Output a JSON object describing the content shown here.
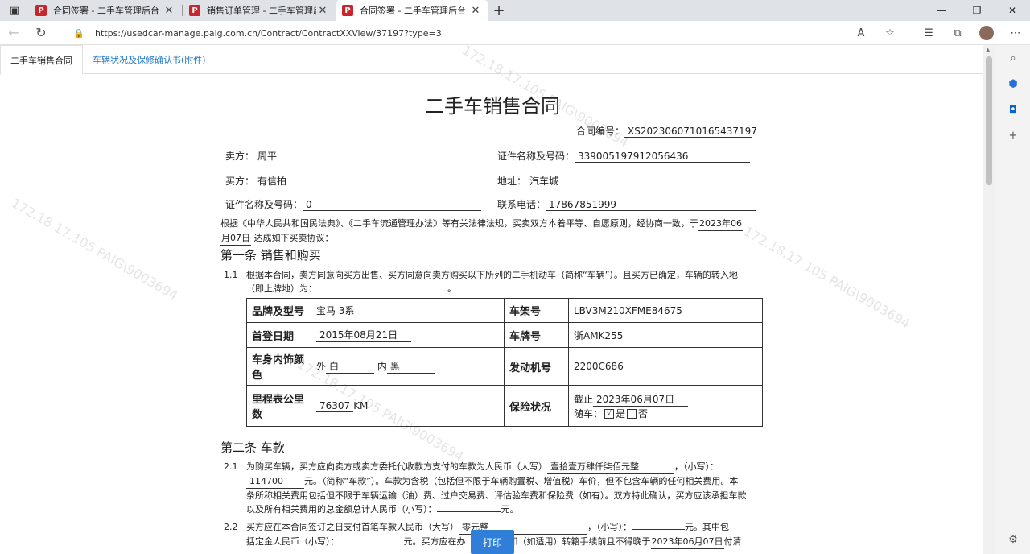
{
  "browser": {
    "tabs": [
      {
        "title": "合同签署 - 二手车管理后台",
        "favicon": "P"
      },
      {
        "title": "销售订单管理 - 二手车管理后台",
        "favicon": "P"
      },
      {
        "title": "合同签署 - 二手车管理后台",
        "favicon": "P"
      }
    ],
    "url": "https://usedcar-manage.paig.com.cn/Contract/ContractXXView/37197?type=3"
  },
  "page_tabs": [
    "二手车销售合同",
    "车辆状况及保修确认书(附件)"
  ],
  "watermark": "172.18.17.105  PAIG\\9003694",
  "contract": {
    "title": "二手车销售合同",
    "contract_no_label": "合同编号：",
    "contract_no": "XS2023060710165437197",
    "seller_label": "卖方：",
    "seller": "周平",
    "seller_id_label": "证件名称及号码：",
    "seller_id": "339005197912056436",
    "buyer_label": "买方：",
    "buyer": "有信拍",
    "address_label": "地址：",
    "address": "汽车城",
    "buyer_id_label": "证件名称及号码：",
    "buyer_id": "0",
    "phone_label": "联系电话：",
    "phone": "17867851999",
    "intro_a": "根据《中华人民共和国民法典》、《二手车流通管理办法》等有关法律法规，买卖双方本着平等、自愿原则，经协商一致，于",
    "intro_date_a": "2023年06",
    "intro_date_b": "月07日",
    "intro_b": "达成如下买卖协议：",
    "section1": "第一条 销售和购买",
    "s1_num": "1.1",
    "s1_text_a": "根据本合同，卖方同意向买方出售、买方同意向卖方购买以下所列的二手机动车（简称“车辆”）。且买方已确定，车辆的转入地",
    "s1_text_b": "（即上牌地）为：",
    "s1_text_end": "。",
    "table": {
      "brand_label": "品牌及型号",
      "brand": "宝马 3系",
      "vin_label": "车架号",
      "vin": "LBV3M210XFME84675",
      "reg_label": "首登日期",
      "reg": "2015年08月21日",
      "plate_label": "车牌号",
      "plate": "浙AMK255",
      "color_label": "车身内饰颜色",
      "color_out_label": "外",
      "color_out": "白",
      "color_in_label": "内",
      "color_in": "黑",
      "engine_label": "发动机号",
      "engine": "2200C686",
      "mileage_label": "里程表公里数",
      "mileage": "76307",
      "mileage_unit": "KM",
      "insurance_label": "保险状况",
      "insurance_until_label": "截止",
      "insurance_until": "2023年06月07日",
      "with_car_label": "随车：",
      "yes": "是",
      "no": "否",
      "checked_mark": "√"
    },
    "section2": "第二条 车款",
    "s21_num": "2.1",
    "s21_a": "为购买车辆，买方应向卖方或卖方委托代收款方支付的车款为人民币（大写）",
    "s21_upper": "壹拾壹万肆仟柒佰元整",
    "s21_b": "，（小写）：",
    "s21_lower": "114700",
    "s21_c": "元。（简称“车款”）。车款为含税（包括但不限于车辆购置税、增值税）车价，但不包含车辆的任何相关费用。本",
    "s21_d": "条所称相关费用包括但不限于车辆运输（油）费、过户交易费、评估验车费和保险费（如有）。双方特此确认，买方应该承担车款",
    "s21_e": "以及所有相关费用的总金额总计人民币（小写）：",
    "s21_f": "元。",
    "s22_num": "2.2",
    "s22_a": "买方应在本合同签订之日支付首笔车款人民币（大写）",
    "s22_upper": "零元整",
    "s22_b": "，（小写）：",
    "s22_c": "元。其中包",
    "s22_d": "括定金人民币（小写）：",
    "s22_e": "元。买方应在办",
    "s22_f": "和（如适用）转籍手续前且不得晚于",
    "s22_date": "2023年06月07日",
    "s22_g": "付清"
  },
  "print_label": "打印"
}
